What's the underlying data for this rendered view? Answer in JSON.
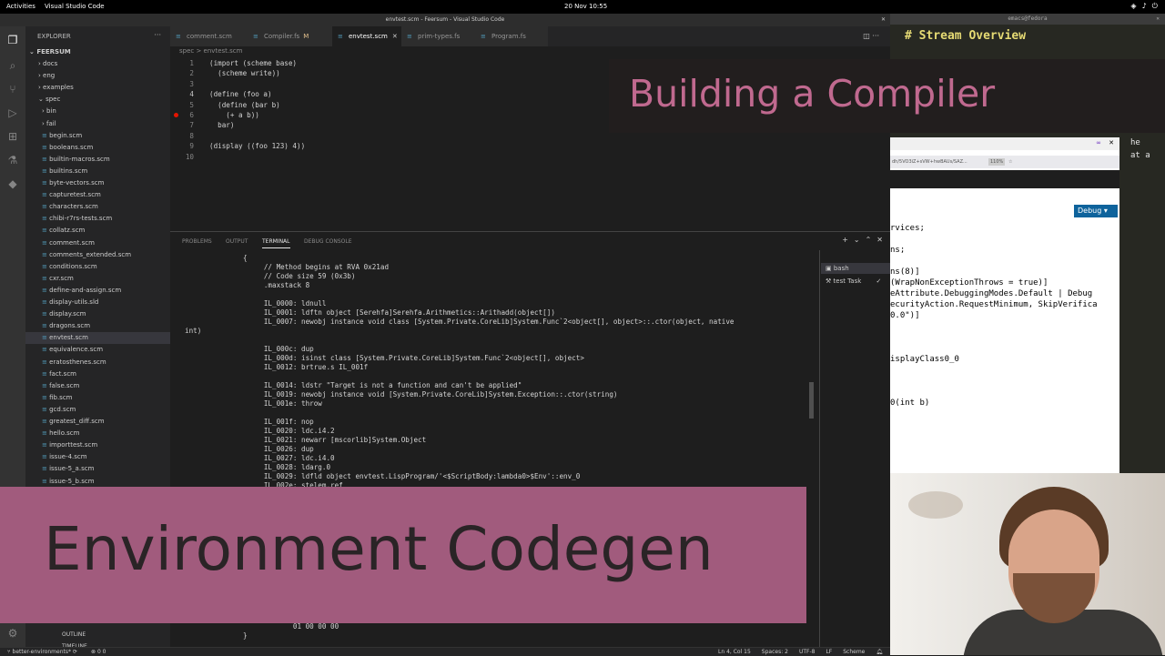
{
  "topbar": {
    "activities": "Activities",
    "app": "Visual Studio Code",
    "clock": "20 Nov  10:55"
  },
  "vscode": {
    "title": "envtest.scm - Feersum - Visual Studio Code",
    "explorer_label": "EXPLORER",
    "root_folder": "FEERSUM",
    "tree": [
      {
        "label": "docs",
        "depth": 1,
        "folder": true
      },
      {
        "label": "eng",
        "depth": 1,
        "folder": true
      },
      {
        "label": "examples",
        "depth": 1,
        "folder": true
      },
      {
        "label": "spec",
        "depth": 1,
        "folder": true,
        "open": true
      },
      {
        "label": "bin",
        "depth": 2,
        "folder": true
      },
      {
        "label": "fail",
        "depth": 2,
        "folder": true
      },
      {
        "label": "begin.scm",
        "depth": 2
      },
      {
        "label": "booleans.scm",
        "depth": 2
      },
      {
        "label": "builtin-macros.scm",
        "depth": 2
      },
      {
        "label": "builtins.scm",
        "depth": 2
      },
      {
        "label": "byte-vectors.scm",
        "depth": 2
      },
      {
        "label": "capturetest.scm",
        "depth": 2
      },
      {
        "label": "characters.scm",
        "depth": 2
      },
      {
        "label": "chibi-r7rs-tests.scm",
        "depth": 2
      },
      {
        "label": "collatz.scm",
        "depth": 2
      },
      {
        "label": "comment.scm",
        "depth": 2
      },
      {
        "label": "comments_extended.scm",
        "depth": 2
      },
      {
        "label": "conditions.scm",
        "depth": 2
      },
      {
        "label": "cxr.scm",
        "depth": 2
      },
      {
        "label": "define-and-assign.scm",
        "depth": 2
      },
      {
        "label": "display-utils.sld",
        "depth": 2
      },
      {
        "label": "display.scm",
        "depth": 2
      },
      {
        "label": "dragons.scm",
        "depth": 2
      },
      {
        "label": "envtest.scm",
        "depth": 2,
        "selected": true
      },
      {
        "label": "equivalence.scm",
        "depth": 2
      },
      {
        "label": "eratosthenes.scm",
        "depth": 2
      },
      {
        "label": "fact.scm",
        "depth": 2
      },
      {
        "label": "false.scm",
        "depth": 2
      },
      {
        "label": "fib.scm",
        "depth": 2
      },
      {
        "label": "gcd.scm",
        "depth": 2
      },
      {
        "label": "greatest_diff.scm",
        "depth": 2
      },
      {
        "label": "hello.scm",
        "depth": 2
      },
      {
        "label": "importtest.scm",
        "depth": 2
      },
      {
        "label": "issue-4.scm",
        "depth": 2
      },
      {
        "label": "issue-5_a.scm",
        "depth": 2
      },
      {
        "label": "issue-5_b.scm",
        "depth": 2
      }
    ],
    "outline_label": "OUTLINE",
    "timeline_label": "TIMELINE",
    "tabs": [
      {
        "label": "comment.scm",
        "active": false,
        "mod": ""
      },
      {
        "label": "Compiler.fs",
        "active": false,
        "mod": "M"
      },
      {
        "label": "envtest.scm",
        "active": true,
        "mod": ""
      },
      {
        "label": "prim-types.fs",
        "active": false,
        "mod": ""
      },
      {
        "label": "Program.fs",
        "active": false,
        "mod": ""
      }
    ],
    "breadcrumb": "spec  >  envtest.scm",
    "code_lines": [
      {
        "n": "1",
        "text": "(import (scheme base)"
      },
      {
        "n": "2",
        "text": "  (scheme write))"
      },
      {
        "n": "3",
        "text": ""
      },
      {
        "n": "4",
        "text": "(define (foo a)"
      },
      {
        "n": "5",
        "text": "  (define (bar b)"
      },
      {
        "n": "6",
        "text": "    (+ a b))"
      },
      {
        "n": "7",
        "text": "  bar)"
      },
      {
        "n": "8",
        "text": ""
      },
      {
        "n": "9",
        "text": "(display ((foo 123) 4))"
      },
      {
        "n": "10",
        "text": ""
      }
    ],
    "panel_tabs": [
      "PROBLEMS",
      "OUTPUT",
      "TERMINAL",
      "DEBUG CONSOLE"
    ],
    "terminal_lines": [
      "              {",
      "                   // Method begins at RVA 0x21ad",
      "                   // Code size 59 (0x3b)",
      "                   .maxstack 8",
      "",
      "                   IL_0000: ldnull",
      "                   IL_0001: ldftn object [Serehfa]Serehfa.Arithmetics::Arithadd(object[])",
      "                   IL_0007: newobj instance void class [System.Private.CoreLib]System.Func`2<object[], object>::.ctor(object, native",
      "int)",
      "",
      "                   IL_000c: dup",
      "                   IL_000d: isinst class [System.Private.CoreLib]System.Func`2<object[], object>",
      "                   IL_0012: brtrue.s IL_001f",
      "",
      "                   IL_0014: ldstr \"Target is not a function and can't be applied\"",
      "                   IL_0019: newobj instance void [System.Private.CoreLib]System.Exception::.ctor(string)",
      "                   IL_001e: throw",
      "",
      "                   IL_001f: nop",
      "                   IL_0020: ldc.i4.2",
      "                   IL_0021: newarr [mscorlib]System.Object",
      "                   IL_0026: dup",
      "                   IL_0027: ldc.i4.0",
      "                   IL_0028: ldarg.0",
      "                   IL_0029: ldfld object envtest.LispProgram/'<$ScriptBody:lambda0>$Env'::env_0",
      "                   IL_002e: stelem.ref",
      "                   IL_002f: dup"
    ],
    "terminal_bottom": [
      "                          01 00 00 00",
      "              }"
    ],
    "terminal_list": [
      "bash",
      "test  Task"
    ],
    "status": {
      "branch": "better-environments*",
      "problems": "0  0",
      "position": "Ln 4, Col 15",
      "spaces": "Spaces: 2",
      "encoding": "UTF-8",
      "eol": "LF",
      "language": "Scheme"
    }
  },
  "emacs": {
    "title": "emacs@fedora",
    "heading": "# Stream Overview",
    "side_lines": [
      "he",
      "at a"
    ]
  },
  "browser": {
    "url": "dh/5VO3iZ+sVW+hwBAUs/SAZ...",
    "zoom": "110%",
    "debug_label": "Debug",
    "code_lines": [
      "rvices;",
      "",
      "ns;",
      "",
      "ns(8)]",
      "(WrapNonExceptionThrows = true)]",
      "eAttribute.DebuggingModes.Default | Debug",
      "ecurityAction.RequestMinimum, SkipVerifica",
      "0.0\")]",
      "",
      "",
      "",
      "isplayClass0_0",
      "",
      "",
      "",
      "0(int b)"
    ]
  },
  "overlay": {
    "top": "Building a Compiler",
    "bottom": "Environment Codegen"
  }
}
